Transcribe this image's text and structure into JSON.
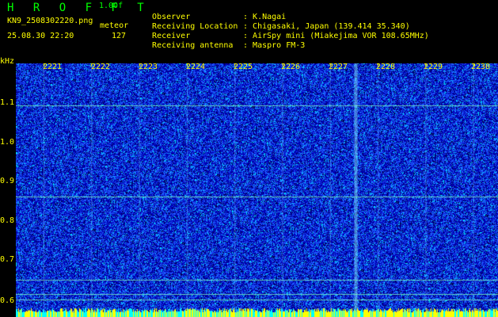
{
  "header": {
    "app_title": "H R O F F T",
    "version": "1.00f",
    "filename": "KN9_2508302220.png",
    "detector": "meteor",
    "datetime": "25.08.30 22:20",
    "count": "127"
  },
  "info": [
    {
      "label": "Observer",
      "value": "K.Nagai"
    },
    {
      "label": "Receiving Location",
      "value": "Chigasaki, Japan (139.414 35.340)"
    },
    {
      "label": "Receiver",
      "value": "AirSpy mini (Miakejima VOR 108.65MHz)"
    },
    {
      "label": "Receiving antenna",
      "value": "Maspro FM-3"
    }
  ],
  "colon": ":",
  "y_axis": {
    "unit": "kHz",
    "ticks": [
      "1.1",
      "1.0",
      "0.9",
      "0.8",
      "0.7",
      "0.6"
    ]
  },
  "x_axis": {
    "ticks": [
      "2221",
      "2222",
      "2223",
      "2224",
      "2225",
      "2226",
      "2227",
      "2228",
      "2229",
      "2230"
    ]
  },
  "colors": {
    "background": "#000000",
    "text": "#ffff00",
    "title": "#00ff00",
    "noise_low": "#0000b4",
    "noise_mid": "#1e5aff",
    "noise_high": "#00e6ff",
    "line": "#7fffbf",
    "bottom_band": "#ffff00"
  }
}
